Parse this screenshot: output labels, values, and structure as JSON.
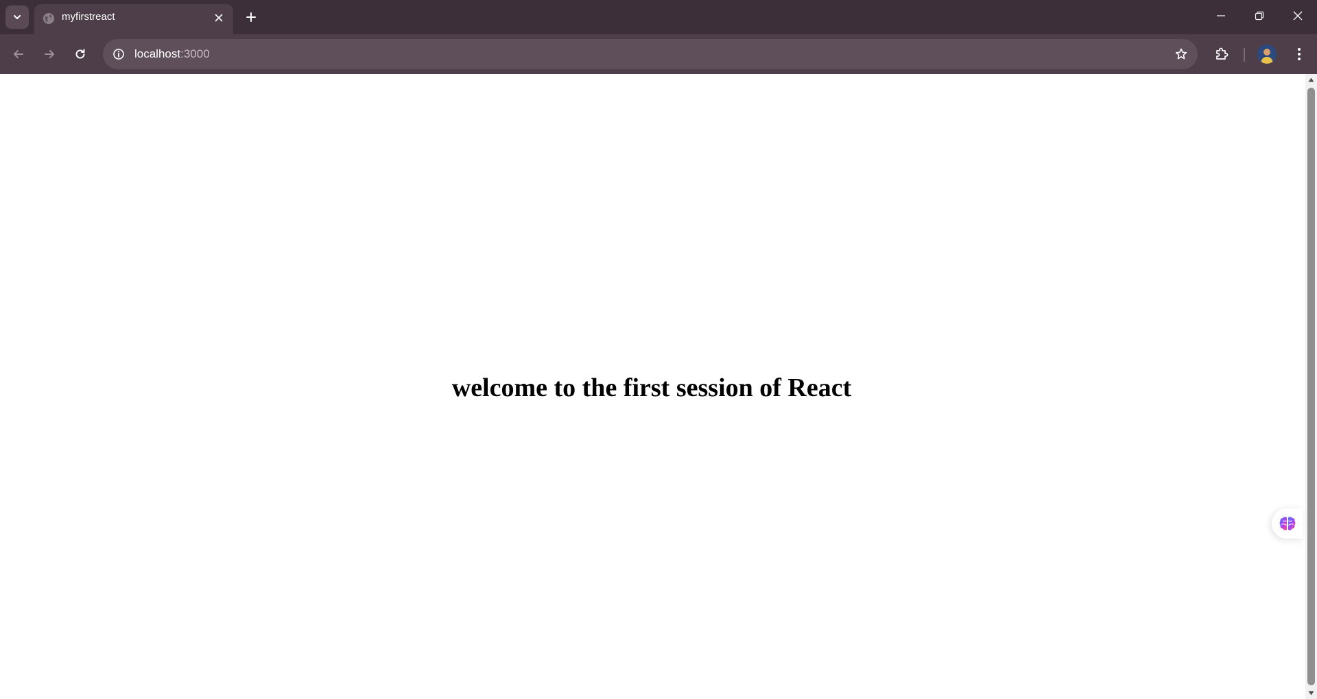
{
  "colors": {
    "tabstrip_bg": "#3d2f3a",
    "toolbar_bg": "#4d3e4a",
    "omnibox_bg": "#5e4f5b",
    "page_bg": "#ffffff",
    "heading_color": "#000000"
  },
  "tabstrip": {
    "tab_search_icon": "chevron-down-icon",
    "active_tab": {
      "favicon": "globe-icon",
      "title": "myfirstreact",
      "close_icon": "close-icon"
    },
    "new_tab_icon": "plus-icon",
    "window_controls": [
      "minimize-icon",
      "restore-icon",
      "close-icon"
    ]
  },
  "toolbar": {
    "back_icon": "arrow-left-icon",
    "forward_icon": "arrow-right-icon",
    "reload_icon": "reload-icon",
    "omnibox": {
      "site_info_icon": "info-icon",
      "url_host": "localhost",
      "url_port": ":3000",
      "bookmark_icon": "star-icon"
    },
    "extensions_icon": "puzzle-icon",
    "profile_icon": "avatar",
    "menu_icon": "kebab-menu-icon"
  },
  "page": {
    "heading": "welcome to the first session of React",
    "floating_widget_icon": "brain-icon"
  }
}
